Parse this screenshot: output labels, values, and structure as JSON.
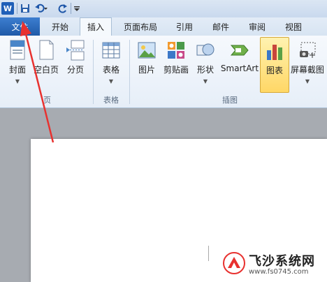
{
  "quick_access": {
    "app_icon": "word-icon",
    "app_letter": "W",
    "save_icon": "save-icon",
    "undo_icon": "undo-icon",
    "redo_icon": "redo-icon",
    "customize_icon": "customize-icon"
  },
  "tabs": [
    {
      "label": "文件",
      "state": "file"
    },
    {
      "label": "开始",
      "state": "normal"
    },
    {
      "label": "插入",
      "state": "active"
    },
    {
      "label": "页面布局",
      "state": "normal"
    },
    {
      "label": "引用",
      "state": "normal"
    },
    {
      "label": "邮件",
      "state": "normal"
    },
    {
      "label": "审阅",
      "state": "normal"
    },
    {
      "label": "视图",
      "state": "normal"
    }
  ],
  "ribbon": {
    "pages_group": {
      "label": "页",
      "buttons": [
        {
          "label": "封面",
          "icon": "cover-page-icon"
        },
        {
          "label": "空白页",
          "icon": "blank-page-icon"
        },
        {
          "label": "分页",
          "icon": "page-break-icon"
        }
      ]
    },
    "tables_group": {
      "label": "表格",
      "buttons": [
        {
          "label": "表格",
          "icon": "table-icon"
        }
      ]
    },
    "illustrations_group": {
      "label": "插图",
      "buttons": [
        {
          "label": "图片",
          "icon": "picture-icon"
        },
        {
          "label": "剪贴画",
          "icon": "clip-art-icon"
        },
        {
          "label": "形状",
          "icon": "shapes-icon"
        },
        {
          "label": "SmartArt",
          "icon": "smartart-icon"
        },
        {
          "label": "图表",
          "icon": "chart-icon",
          "highlighted": true
        },
        {
          "label": "屏幕截图",
          "icon": "screenshot-icon"
        }
      ]
    }
  },
  "annotation": {
    "arrow_color": "#e8312f",
    "points_to": "文件"
  },
  "watermark": {
    "title": "飞沙系统网",
    "url": "www.fs0745.com",
    "logo": "fs-logo-icon"
  },
  "colors": {
    "file_tab": "#1f5aa8",
    "ribbon_bg": "#e6eef8",
    "chart_highlight": "#ffd766"
  }
}
